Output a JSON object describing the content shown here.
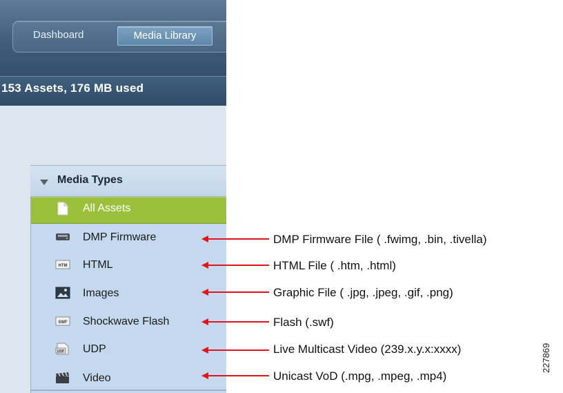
{
  "nav": {
    "tabs": [
      {
        "label": "Dashboard",
        "selected": false
      },
      {
        "label": "Media Library",
        "selected": true
      }
    ]
  },
  "assets_summary": "153 Assets, 176 MB used",
  "media_types": {
    "title": "Media Types",
    "items": [
      {
        "label": "All Assets",
        "icon": "document-icon",
        "selected": true
      },
      {
        "label": "DMP Firmware",
        "icon": "firmware-device-icon"
      },
      {
        "label": "HTML",
        "icon": "html-file-icon"
      },
      {
        "label": "Images",
        "icon": "image-icon"
      },
      {
        "label": "Shockwave Flash",
        "icon": "swf-file-icon"
      },
      {
        "label": "UDP",
        "icon": "udp-file-icon"
      },
      {
        "label": "Video",
        "icon": "clapperboard-icon"
      }
    ]
  },
  "annotations": [
    "DMP Firmware File ( .fwimg, .bin, .tivella)",
    "HTML File ( .htm, .html)",
    "Graphic File ( .jpg, .jpeg, .gif, .png)",
    "Flash (.swf)",
    "Live Multicast Video (239.x.y.x:xxxx)",
    "Unicast VoD (.mpg, .mpeg, .mp4)"
  ],
  "figure_id": "227869",
  "colors": {
    "selected_row": "#9bc13c",
    "arrow": "#e0141b",
    "header_bar": "#3e5c79"
  }
}
